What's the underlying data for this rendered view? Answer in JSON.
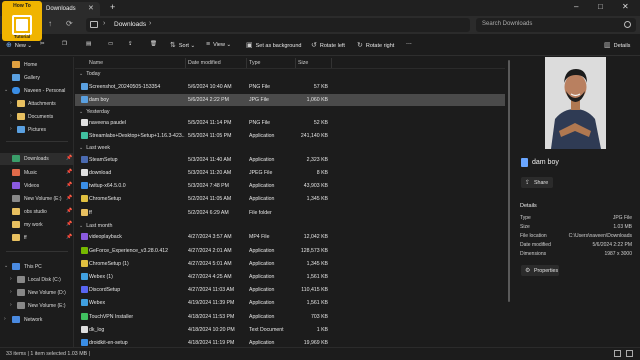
{
  "logo": {
    "line1": "How To",
    "line2": "Tutorial"
  },
  "tab": {
    "label": "Downloads"
  },
  "window": {
    "minimize": "–",
    "maximize": "□",
    "close": "✕"
  },
  "address": {
    "path": "Downloads",
    "search_placeholder": "Search Downloads"
  },
  "commands": {
    "new": "New",
    "sort": "Sort",
    "view": "View",
    "set_background": "Set as background",
    "rotate_left": "Rotate left",
    "rotate_right": "Rotate right",
    "more": "...",
    "details": "Details"
  },
  "sidebar": {
    "items": [
      {
        "label": "Home",
        "color": "#e0a040"
      },
      {
        "label": "Gallery",
        "color": "#5aa0e0"
      },
      {
        "label": "Naveen - Personal",
        "color": "#3a8ee6"
      },
      {
        "label": "Attachments",
        "color": "#e8c060"
      },
      {
        "label": "Documents",
        "color": "#e8c060"
      },
      {
        "label": "Pictures",
        "color": "#5aa0e0"
      },
      {
        "label": "Downloads",
        "color": "#3a9e6a"
      },
      {
        "label": "Music",
        "color": "#e06a4a"
      },
      {
        "label": "Videos",
        "color": "#8a5ae0"
      },
      {
        "label": "New Volume (E:)",
        "color": "#888888"
      },
      {
        "label": "obs studio",
        "color": "#e8c060"
      },
      {
        "label": "my work",
        "color": "#e8c060"
      },
      {
        "label": "ff",
        "color": "#e8c060"
      },
      {
        "label": "This PC",
        "color": "#4a8ae0"
      },
      {
        "label": "Local Disk (C:)",
        "color": "#888888"
      },
      {
        "label": "New Volume (D:)",
        "color": "#888888"
      },
      {
        "label": "New Volume (E:)",
        "color": "#888888"
      },
      {
        "label": "Network",
        "color": "#4a8ae0"
      }
    ]
  },
  "columns": {
    "name": "Name",
    "date": "Date modified",
    "type": "Type",
    "size": "Size"
  },
  "groups": {
    "today": "Today",
    "yesterday": "Yesterday",
    "last_week": "Last week",
    "last_month": "Last month"
  },
  "files": [
    {
      "name": "Screenshot_20240505-153354",
      "date": "5/6/2024 10:40 AM",
      "type": "PNG File",
      "size": "57 KB",
      "color": "#5aa0e0"
    },
    {
      "name": "dam boy",
      "date": "5/6/2024 2:22 PM",
      "type": "JPG File",
      "size": "1,060 KB",
      "color": "#5aa0e0"
    },
    {
      "name": "naveena paudel",
      "date": "5/5/2024 11:14 PM",
      "type": "PNG File",
      "size": "52 KB",
      "color": "#e0e0e0"
    },
    {
      "name": "Streamlabs+Desktop+Setup+1.16.3-423...",
      "date": "5/5/2024 11:05 PM",
      "type": "Application",
      "size": "241,140 KB",
      "color": "#40c0a0"
    },
    {
      "name": "SteamSetup",
      "date": "5/3/2024 11:40 AM",
      "type": "Application",
      "size": "2,323 KB",
      "color": "#4a6ab0"
    },
    {
      "name": "download",
      "date": "5/3/2024 11:20 AM",
      "type": "JPEG File",
      "size": "8 KB",
      "color": "#e0e0e0"
    },
    {
      "name": "twitup-x64.5.0.0",
      "date": "5/3/2024 7:48 PM",
      "type": "Application",
      "size": "43,903 KB",
      "color": "#3a8ee6"
    },
    {
      "name": "ChromeSetup",
      "date": "5/2/2024 11:05 AM",
      "type": "Application",
      "size": "1,345 KB",
      "color": "#e0c040"
    },
    {
      "name": "ff",
      "date": "5/2/2024 6:29 AM",
      "type": "File folder",
      "size": "",
      "color": "#e8c060"
    },
    {
      "name": "videoplayback",
      "date": "4/27/2024 3:57 AM",
      "type": "MP4 File",
      "size": "12,042 KB",
      "color": "#8a5ae0"
    },
    {
      "name": "GeForce_Experience_v3.28.0.412",
      "date": "4/27/2024 2:01 AM",
      "type": "Application",
      "size": "128,573 KB",
      "color": "#76b900"
    },
    {
      "name": "ChromeSetup (1)",
      "date": "4/27/2024 5:01 AM",
      "type": "Application",
      "size": "1,345 KB",
      "color": "#e0c040"
    },
    {
      "name": "Webex (1)",
      "date": "4/27/2024 4:25 AM",
      "type": "Application",
      "size": "1,561 KB",
      "color": "#40a0e0"
    },
    {
      "name": "DiscordSetup",
      "date": "4/27/2024 11:03 AM",
      "type": "Application",
      "size": "110,415 KB",
      "color": "#5865f2"
    },
    {
      "name": "Webex",
      "date": "4/19/2024 11:39 PM",
      "type": "Application",
      "size": "1,561 KB",
      "color": "#40a0e0"
    },
    {
      "name": "TouchVPN Installer",
      "date": "4/18/2024 11:53 PM",
      "type": "Application",
      "size": "703 KB",
      "color": "#40c060"
    },
    {
      "name": "dk_log",
      "date": "4/18/2024 10:20 PM",
      "type": "Text Document",
      "size": "1 KB",
      "color": "#e0e0e0"
    },
    {
      "name": "droidkit-en-setup",
      "date": "4/18/2024 11:19 PM",
      "type": "Application",
      "size": "19,969 KB",
      "color": "#3a8ee6"
    }
  ],
  "details": {
    "title": "dam boy",
    "share": "Share",
    "heading": "Details",
    "rows": [
      {
        "k": "Type",
        "v": "JPG File"
      },
      {
        "k": "Size",
        "v": "1.03 MB"
      },
      {
        "k": "File location",
        "v": "C:\\Users\\naveen\\Downloads"
      },
      {
        "k": "Date modified",
        "v": "5/6/2024 2:22 PM"
      },
      {
        "k": "Dimensions",
        "v": "1987 x 3000"
      }
    ],
    "properties": "Properties"
  },
  "status": {
    "text": "33 items  |  1 item selected  1.03 MB  |"
  }
}
